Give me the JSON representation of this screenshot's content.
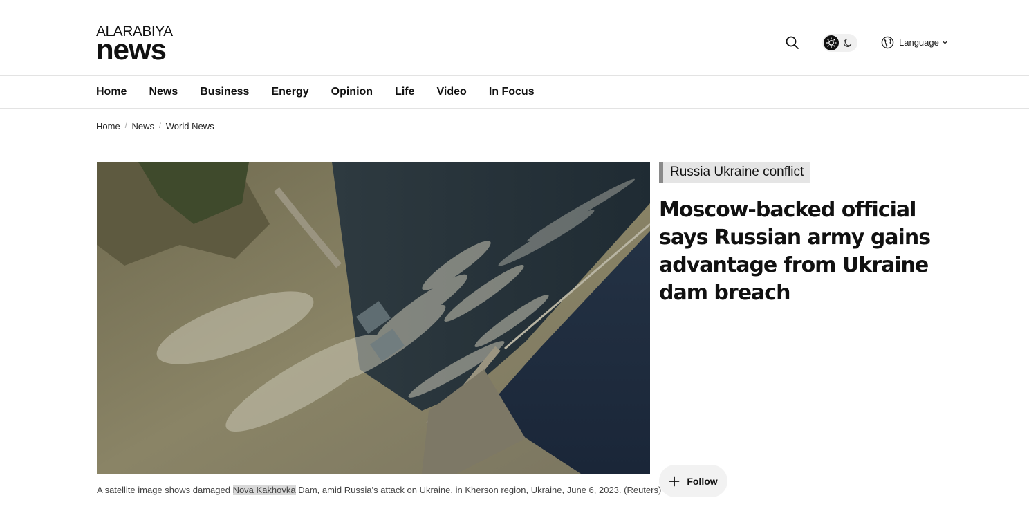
{
  "brand": {
    "logo_top": "ALARABIYA",
    "logo_bottom": "news"
  },
  "header": {
    "search_icon": "search-icon",
    "theme_toggle": {
      "light_icon": "sun-icon",
      "dark_icon": "moon-icon",
      "active": "light"
    },
    "language": {
      "icon": "globe-icon",
      "label": "Language"
    }
  },
  "nav": {
    "items": [
      {
        "label": "Home"
      },
      {
        "label": "News"
      },
      {
        "label": "Business"
      },
      {
        "label": "Energy"
      },
      {
        "label": "Opinion"
      },
      {
        "label": "Life"
      },
      {
        "label": "Video"
      },
      {
        "label": "In Focus"
      }
    ]
  },
  "breadcrumb": {
    "items": [
      {
        "label": "Home"
      },
      {
        "label": "News"
      },
      {
        "label": "World News"
      }
    ]
  },
  "article": {
    "tag": "Russia Ukraine conflict",
    "headline": "Moscow-backed official says Russian army gains advantage from Ukraine dam breach",
    "image_alt": "Satellite image of damaged dam",
    "caption": {
      "before": "A satellite image shows damaged ",
      "highlight": "Nova Kakhovka",
      "after": " Dam, amid Russia’s attack on Ukraine, in Kherson region, Ukraine, June 6, 2023. (Reuters)"
    },
    "follow_label": "Follow"
  },
  "colors": {
    "text": "#111111",
    "tag_bg": "#e5e5e5",
    "tag_bar": "#8a8a8a",
    "divider": "#e3e3e3"
  }
}
